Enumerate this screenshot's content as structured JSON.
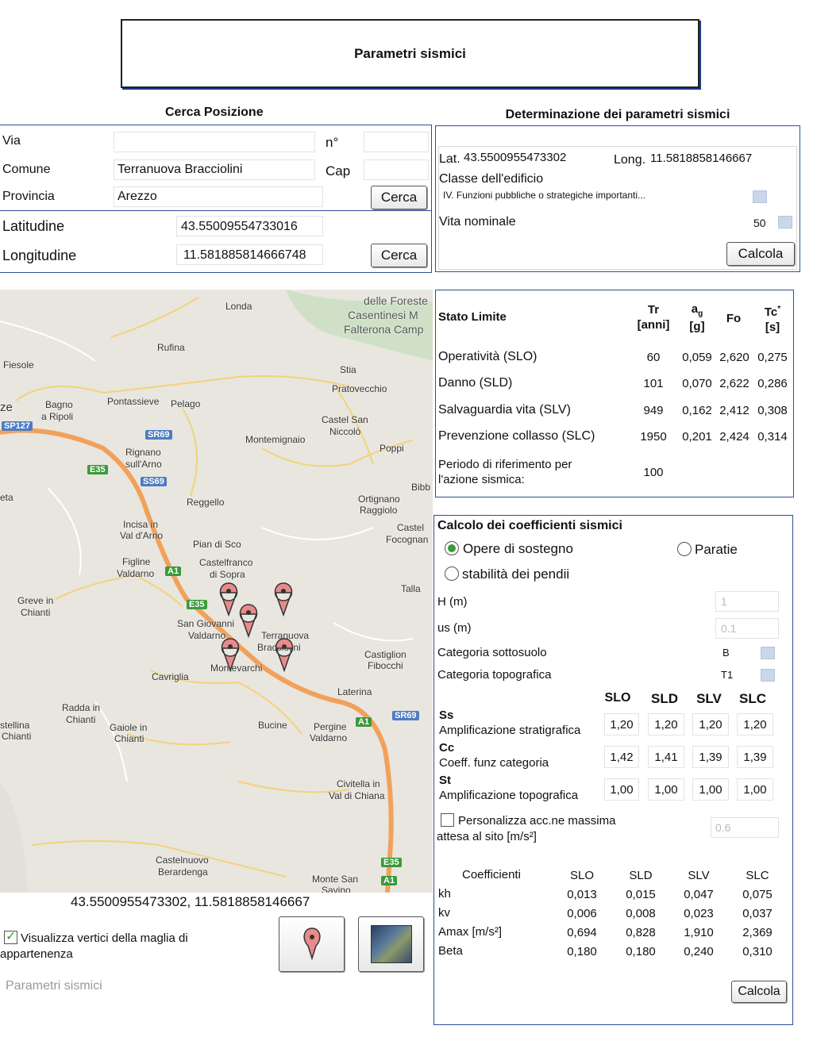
{
  "header": {
    "title": "Parametri sismici"
  },
  "cerca": {
    "title": "Cerca Posizione",
    "via_label": "Via",
    "via_value": "",
    "numero_label": "n°",
    "numero_value": "",
    "comune_label": "Comune",
    "comune_value": "Terranuova Bracciolini",
    "cap_label": "Cap",
    "cap_value": "",
    "provincia_label": "Provincia",
    "provincia_value": "Arezzo",
    "cerca_button": "Cerca",
    "latitudine_label": "Latitudine",
    "latitudine_value": "43.55009554733016",
    "longitudine_label": "Longitudine",
    "longitudine_value": "11.581885814666748",
    "cerca_button2": "Cerca"
  },
  "determinazione": {
    "title": "Determinazione dei parametri sismici",
    "lat_label": "Lat.",
    "lat_value": "43.5500955473302",
    "long_label": "Long.",
    "long_value": "11.5818858146667",
    "classe_label": "Classe dell'edificio",
    "classe_value": "IV. Funzioni pubbliche o strategiche importanti...",
    "vita_label": "Vita nominale",
    "vita_value": "50",
    "calcola_button": "Calcola"
  },
  "stati": {
    "headers": {
      "stato": "Stato Limite",
      "tr": "Tr",
      "tr_unit": "[anni]",
      "ag": "a",
      "ag_sub": "g",
      "ag_unit": "[g]",
      "fo": "Fo",
      "tc": "Tc",
      "tc_sup": "*",
      "tc_unit": "[s]"
    },
    "rows": [
      {
        "label": "Operatività (SLO)",
        "tr": "60",
        "ag": "0,059",
        "fo": "2,620",
        "tc": "0,275"
      },
      {
        "label": "Danno (SLD)",
        "tr": "101",
        "ag": "0,070",
        "fo": "2,622",
        "tc": "0,286"
      },
      {
        "label": "Salvaguardia vita (SLV)",
        "tr": "949",
        "ag": "0,162",
        "fo": "2,412",
        "tc": "0,308"
      },
      {
        "label": "Prevenzione collasso (SLC)",
        "tr": "1950",
        "ag": "0,201",
        "fo": "2,424",
        "tc": "0,314"
      }
    ],
    "periodo_label_1": "Periodo di riferimento per",
    "periodo_label_2": "l'azione sismica:",
    "periodo_value": "100"
  },
  "coeff": {
    "title": "Calcolo dei coefficienti sismici",
    "opt_opere": "Opere di sostegno",
    "opt_paratie": "Paratie",
    "opt_stabilita": "stabilità dei pendii",
    "h_label": "H (m)",
    "h_value": "1",
    "us_label": "us (m)",
    "us_value": "0.1",
    "sottosuolo_label": "Categoria sottosuolo",
    "sottosuolo_value": "B",
    "topografica_label": "Categoria topografica",
    "topografica_value": "T1",
    "states": [
      "SLO",
      "SLD",
      "SLV",
      "SLC"
    ],
    "ss_title": "Ss",
    "ss_desc": "Amplificazione stratigrafica",
    "ss_values": [
      "1,20",
      "1,20",
      "1,20",
      "1,20"
    ],
    "cc_title": "Cc",
    "cc_desc": "Coeff. funz categoria",
    "cc_values": [
      "1,42",
      "1,41",
      "1,39",
      "1,39"
    ],
    "st_title": "St",
    "st_desc": "Amplificazione topografica",
    "st_values": [
      "1,00",
      "1,00",
      "1,00",
      "1,00"
    ],
    "personalizza_1": "Personalizza acc.ne massima",
    "personalizza_2": "attesa al sito [m/s²]",
    "personalizza_value": "0.6",
    "coeff_header": "Coefficienti",
    "results": [
      {
        "label": "kh",
        "values": [
          "0,013",
          "0,015",
          "0,047",
          "0,075"
        ]
      },
      {
        "label": "kv",
        "values": [
          "0,006",
          "0,008",
          "0,023",
          "0,037"
        ]
      },
      {
        "label": "Amax [m/s²]",
        "values": [
          "0,694",
          "0,828",
          "1,910",
          "2,369"
        ]
      },
      {
        "label": "Beta",
        "values": [
          "0,180",
          "0,180",
          "0,240",
          "0,310"
        ]
      }
    ],
    "calcola_button": "Calcola"
  },
  "map": {
    "cities": {
      "londa": "Londa",
      "foreste_1": "delle Foreste",
      "foreste_2": "Casentinesi M",
      "foreste_3": "Falterona Camp",
      "rufina": "Rufina",
      "fiesole": "Fiesole",
      "stia": "Stia",
      "pratovecchio": "Pratovecchio",
      "ze": "ze",
      "bagno_1": "Bagno",
      "bagno_2": "a Ripoli",
      "pontassieve": "Pontassieve",
      "pelago": "Pelago",
      "castelsan_1": "Castel San",
      "castelsan_2": "Niccolò",
      "montemignaio": "Montemignaio",
      "poppi": "Poppi",
      "rignano_1": "Rignano",
      "rignano_2": "sull'Arno",
      "bibb": "Bibb",
      "eta": "eta",
      "reggello": "Reggello",
      "ortignano_1": "Ortignano",
      "ortignano_2": "Raggiolo",
      "incisa_1": "Incisa in",
      "incisa_2": "Val d'Arno",
      "castelfoc_1": "Castel",
      "castelfoc_2": "Focognan",
      "piandisco": "Pian di Sco",
      "figline_1": "Figline",
      "figline_2": "Valdarno",
      "castelfranco_1": "Castelfranco",
      "castelfranco_2": "di Sopra",
      "talla": "Talla",
      "greve_1": "Greve in",
      "greve_2": "Chianti",
      "sangiov_1": "San Giovanni",
      "sangiov_2": "Valdarno",
      "terranuova_1": "Terranuova",
      "terranuova_2": "Bracciolini",
      "castiglion_1": "Castiglion",
      "castiglion_2": "Fibocchi",
      "cavriglia": "Cavriglia",
      "montevarchi": "Montevarchi",
      "laterina": "Laterina",
      "radda_1": "Radda in",
      "radda_2": "Chianti",
      "castellina_1": "stellina",
      "castellina_2": "Chianti",
      "gaiole_1": "Gaiole in",
      "gaiole_2": "Chianti",
      "bucine": "Bucine",
      "pergine_1": "Pergine",
      "pergine_2": "Valdarno",
      "civitella_1": "Civitella in",
      "civitella_2": "Val di Chiana",
      "castelnuovo_1": "Castelnuovo",
      "castelnuovo_2": "Berardenga",
      "montesan_1": "Monte San",
      "montesan_2": "Savino"
    },
    "shields": {
      "sp127": "SP127",
      "sr69a": "SR69",
      "e35a": "E35",
      "ss69": "SS69",
      "a1a": "A1",
      "e35b": "E35",
      "a1b": "A1",
      "sr69b": "SR69",
      "e35c": "E35",
      "a1c": "A1"
    },
    "coords_caption": "43.5500955473302, 11.5818858146667",
    "visualizza_1": "Visualizza vertici della maglia di",
    "visualizza_2": "appartenenza",
    "footer_link": "Parametri sismici"
  },
  "colors": {
    "border_blue": "#2d4f96",
    "highway": "#f2a15b",
    "pin": "#e88b8b",
    "map_land": "#e8e6df"
  }
}
